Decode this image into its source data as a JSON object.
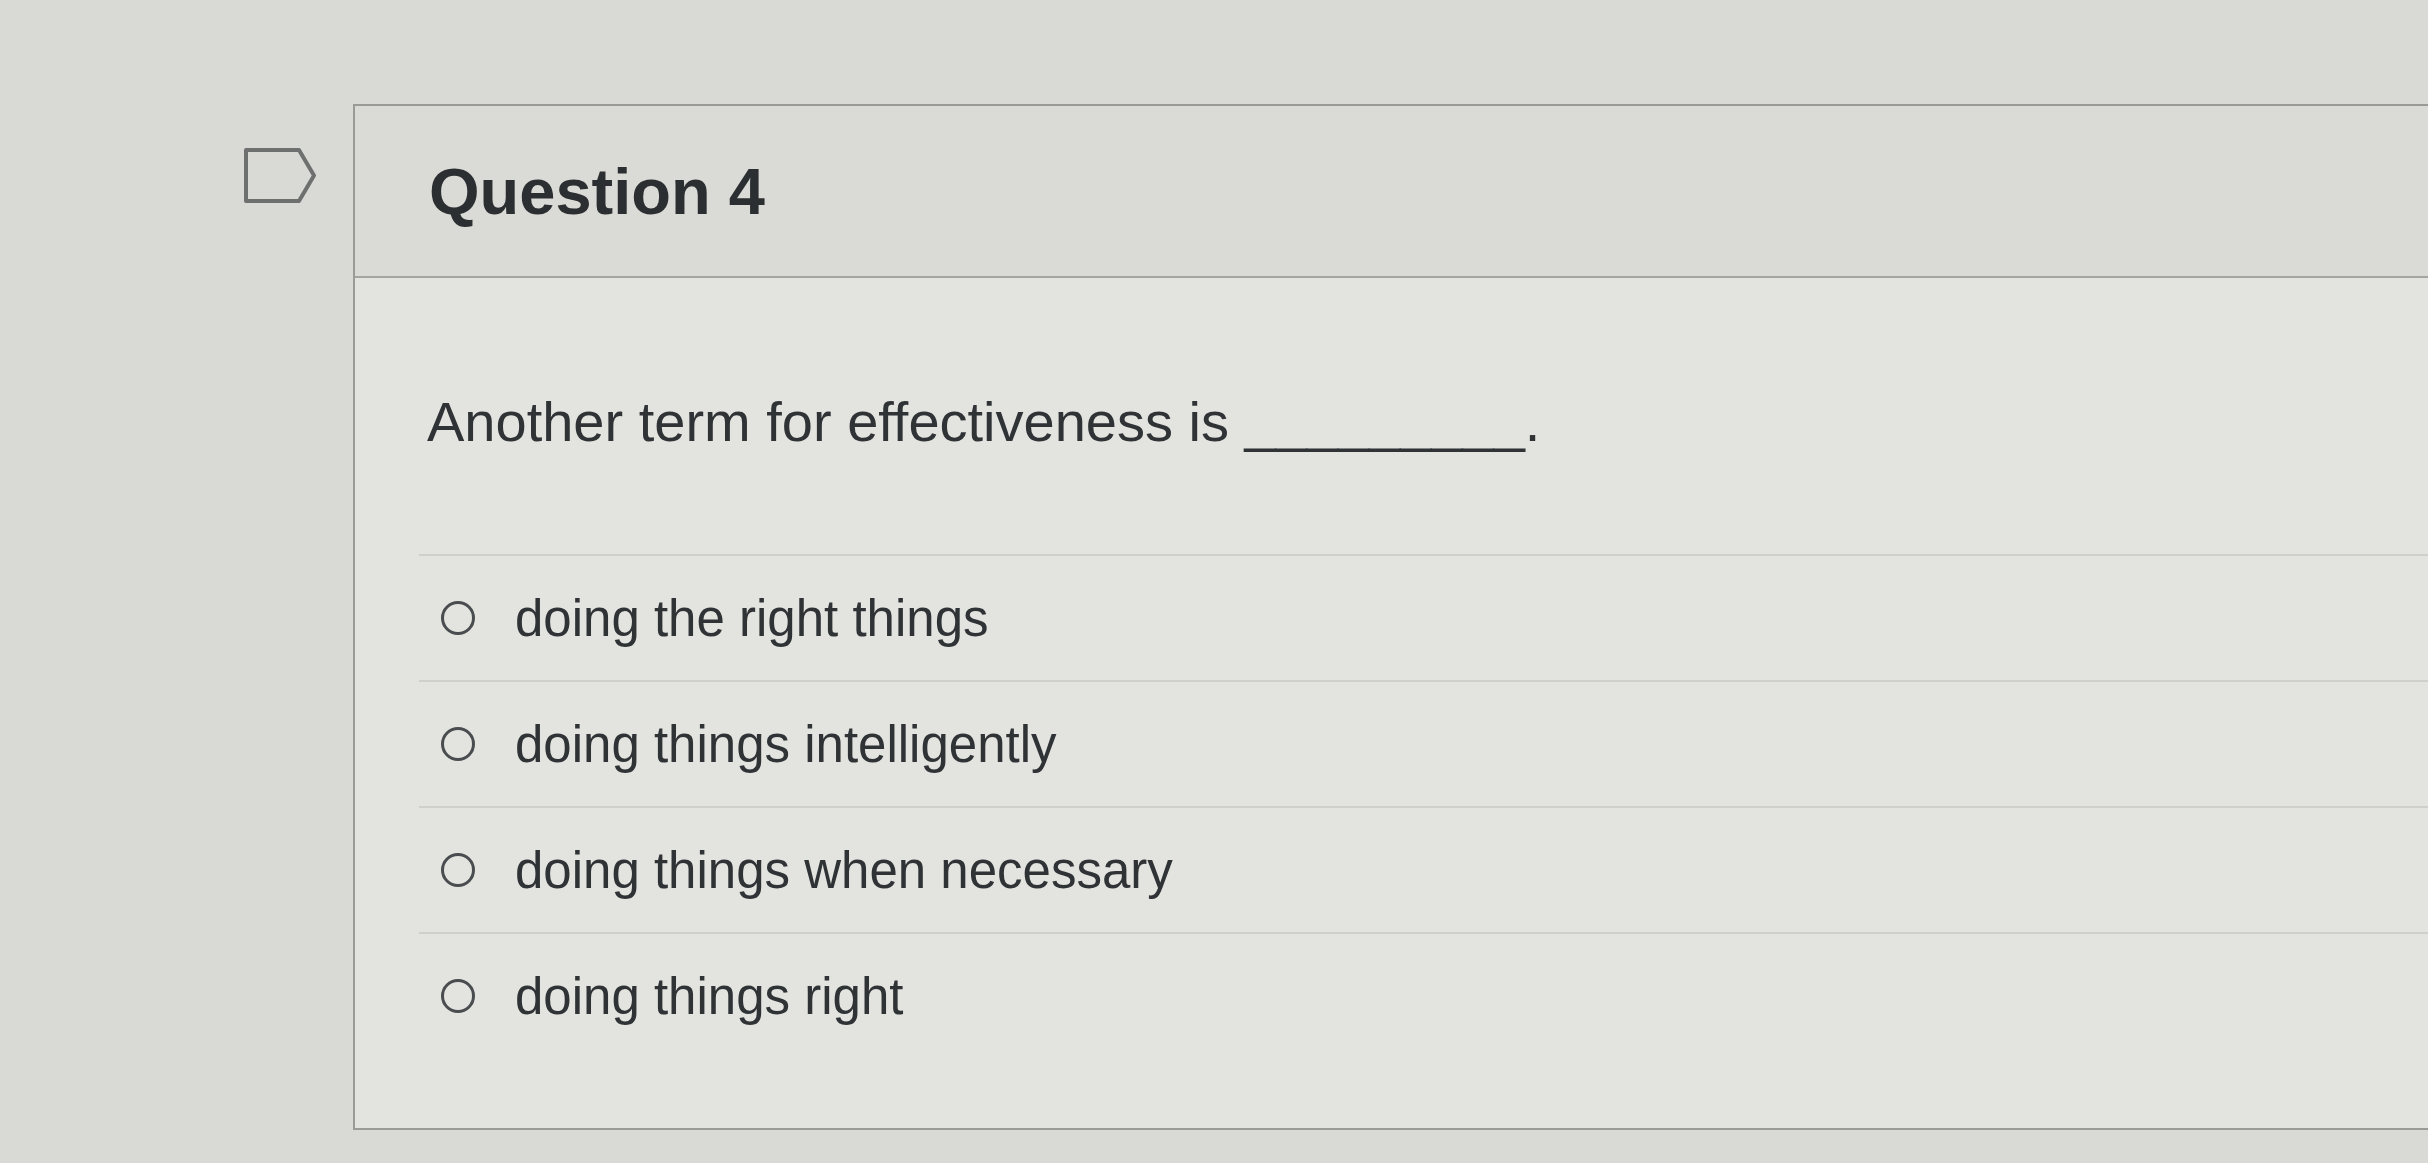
{
  "question": {
    "title": "Question 4",
    "flagged": false,
    "text": "Another term for effectiveness is _________.",
    "options": [
      {
        "label": "doing the right things",
        "selected": false
      },
      {
        "label": "doing things intelligently",
        "selected": false
      },
      {
        "label": "doing things when necessary",
        "selected": false
      },
      {
        "label": "doing things right",
        "selected": false
      }
    ]
  }
}
